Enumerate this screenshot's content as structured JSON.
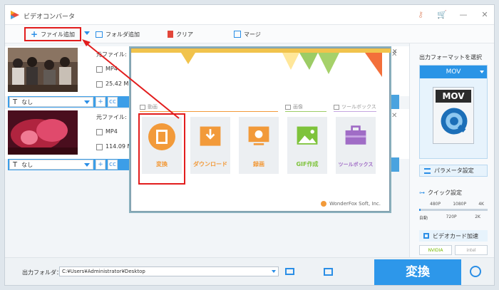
{
  "window": {
    "title": "ビデオコンバータ"
  },
  "toolbar": {
    "add_file": "ファイル追加",
    "add_folder": "フォルダ追加",
    "clear": "クリア",
    "merge": "マージ"
  },
  "files": [
    {
      "source_label": "元ファイル:",
      "format": "MP4",
      "size": "25.42 M",
      "subtitle": "なし",
      "cc": "cc"
    },
    {
      "source_label": "元ファイル:",
      "format": "MP4",
      "size": "114.09 M",
      "subtitle": "なし",
      "cc": "cc"
    }
  ],
  "right_panel": {
    "output_format_label": "出力フォーマットを選択",
    "format_selected": "MOV",
    "format_icon_text": "MOV",
    "param_button": "パラメータ設定",
    "quick_setting": "クイック設定",
    "quality_top": [
      "480P",
      "1080P",
      "4K"
    ],
    "quality_bottom": [
      "自動",
      "720P",
      "2K"
    ],
    "gpu_accel": "ビデオカード加速",
    "nvidia": "NVIDIA",
    "intel": "intel"
  },
  "bottom": {
    "output_folder_label": "出力フォルダ：",
    "output_path": "C:¥Users¥Administrator¥Desktop",
    "convert_button": "変換"
  },
  "dialog": {
    "section_video": "動画",
    "section_image": "画像",
    "section_toolbox": "ツールボックス",
    "items": [
      "変換",
      "ダウンロード",
      "録画",
      "GIF作成",
      "ツールボックス"
    ],
    "brand": "WonderFox Soft, Inc."
  },
  "colors": {
    "accent_blue": "#2d97ea",
    "highlight_red": "#e21d1d",
    "orange": "#f29a3a",
    "green": "#7ec33b",
    "purple": "#a06cc6"
  }
}
